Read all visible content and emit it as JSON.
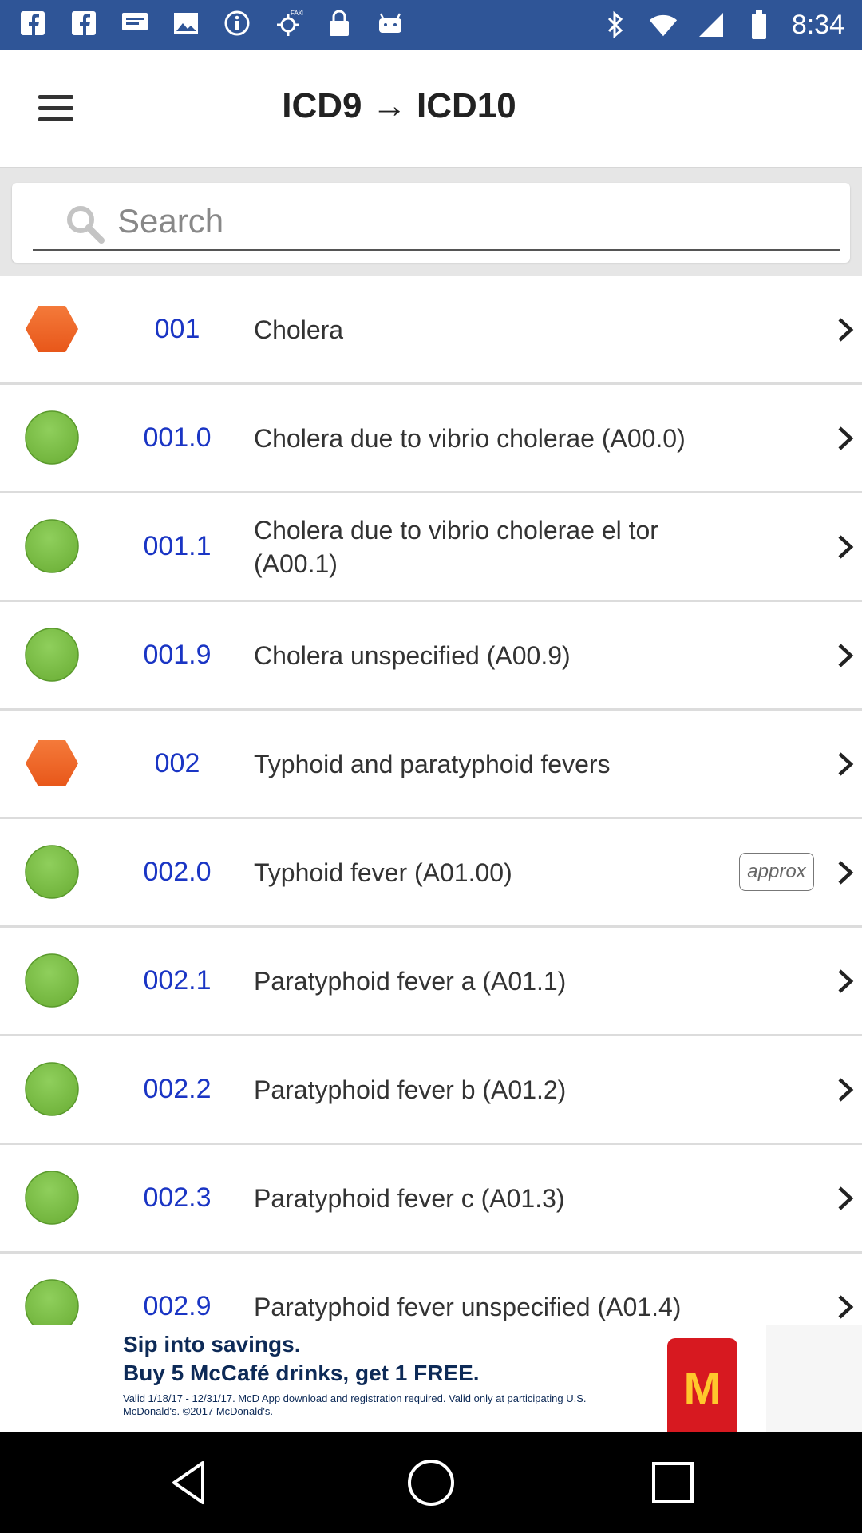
{
  "status_bar": {
    "time": "8:34",
    "left_icons": [
      "facebook-icon",
      "facebook-icon",
      "message-icon",
      "image-icon",
      "info-icon",
      "fake-gps-icon",
      "lock-icon",
      "android-icon"
    ],
    "right_icons": [
      "bluetooth-icon",
      "wifi-icon",
      "signal-icon",
      "battery-icon"
    ],
    "color": "#2f5597"
  },
  "app_bar": {
    "title": "ICD9 → ICD10",
    "menu_icon": "hamburger-icon"
  },
  "search": {
    "placeholder": "Search",
    "value": ""
  },
  "list": [
    {
      "code": "001",
      "description": "Cholera",
      "badge": "hexagon",
      "badge_color": "#e8571a",
      "approx": ""
    },
    {
      "code": "001.0",
      "description": "Cholera due to vibrio cholerae (A00.0)",
      "badge": "circle",
      "badge_color": "#6fb23a",
      "approx": ""
    },
    {
      "code": "001.1",
      "description": "Cholera due to vibrio cholerae el tor (A00.1)",
      "badge": "circle",
      "badge_color": "#6fb23a",
      "approx": ""
    },
    {
      "code": "001.9",
      "description": "Cholera unspecified (A00.9)",
      "badge": "circle",
      "badge_color": "#6fb23a",
      "approx": ""
    },
    {
      "code": "002",
      "description": "Typhoid and paratyphoid fevers",
      "badge": "hexagon",
      "badge_color": "#e8571a",
      "approx": ""
    },
    {
      "code": "002.0",
      "description": "Typhoid fever (A01.00)",
      "badge": "circle",
      "badge_color": "#6fb23a",
      "approx": "approx"
    },
    {
      "code": "002.1",
      "description": "Paratyphoid fever a (A01.1)",
      "badge": "circle",
      "badge_color": "#6fb23a",
      "approx": ""
    },
    {
      "code": "002.2",
      "description": "Paratyphoid fever b (A01.2)",
      "badge": "circle",
      "badge_color": "#6fb23a",
      "approx": ""
    },
    {
      "code": "002.3",
      "description": "Paratyphoid fever c (A01.3)",
      "badge": "circle",
      "badge_color": "#6fb23a",
      "approx": ""
    },
    {
      "code": "002.9",
      "description": "Paratyphoid fever unspecified (A01.4)",
      "badge": "circle",
      "badge_color": "#6fb23a",
      "approx": ""
    }
  ],
  "ad": {
    "line1": "Sip into savings.",
    "line2": "Buy 5 McCafé drinks, get 1 FREE.",
    "line3": "Valid 1/18/17 - 12/31/17. McD App download and registration required. Valid only at participating U.S. McDonald's. ©2017 McDonald's.",
    "logo_letter": "M"
  },
  "nav_bar": {
    "buttons": [
      "back-icon",
      "home-icon",
      "recents-icon"
    ]
  }
}
